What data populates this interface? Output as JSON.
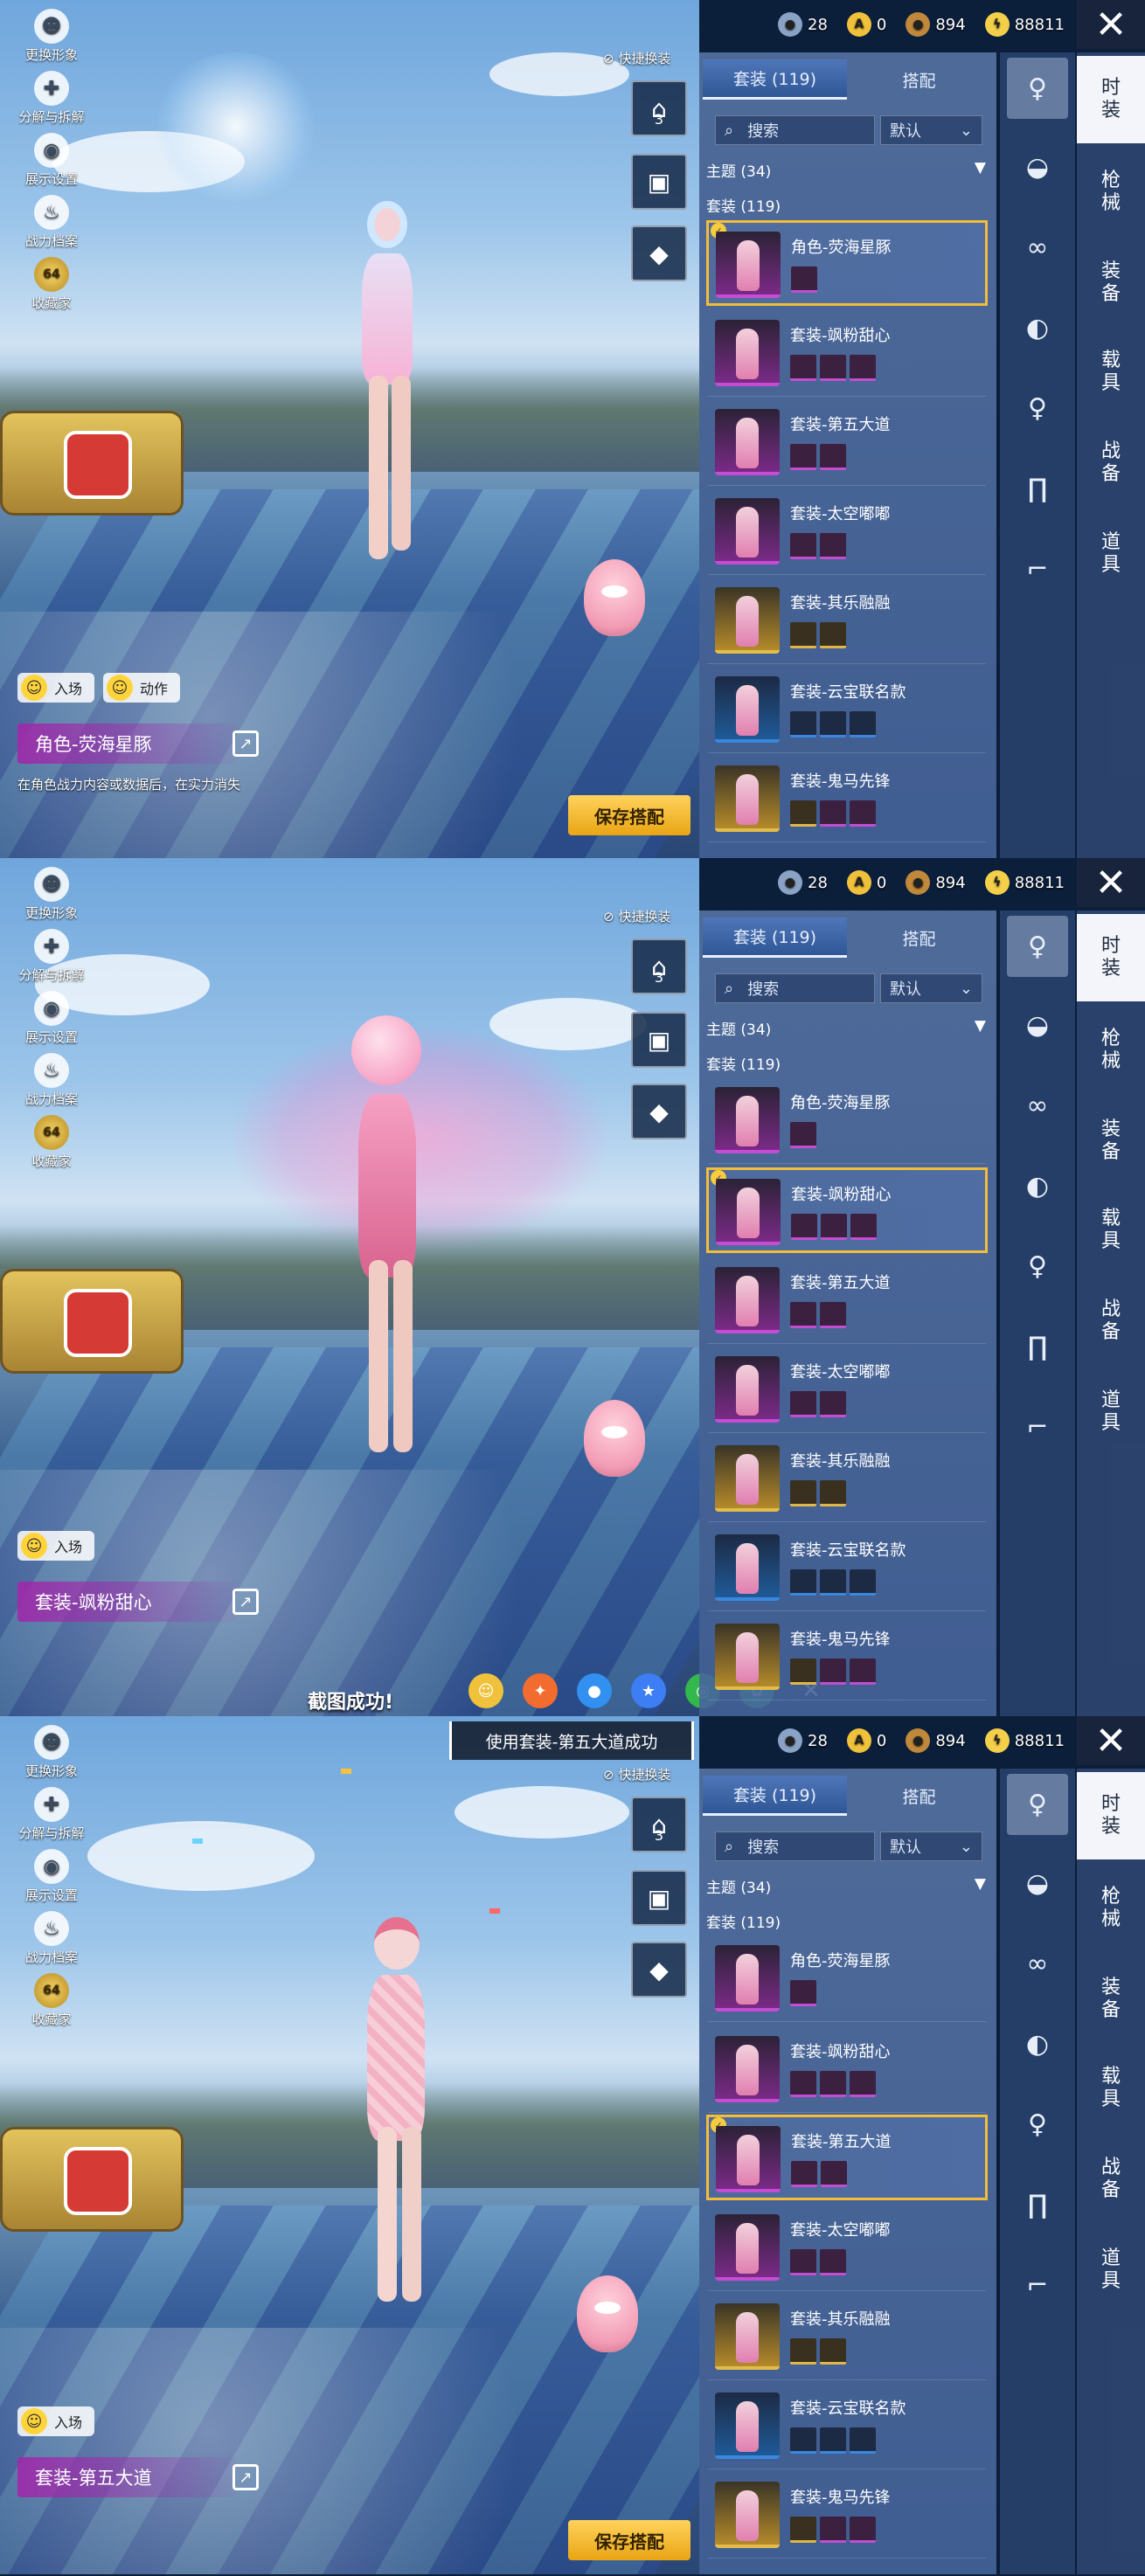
{
  "currency": {
    "a": "28",
    "b": "0",
    "c": "894",
    "d": "88811"
  },
  "left_menu": [
    "更换形象",
    "分解与拆解",
    "展示设置",
    "战力档案",
    "收藏家"
  ],
  "collector_level": "64",
  "quick_swap": "快捷换装",
  "wardrobe_number": "3",
  "tabs": [
    "套装 (119)",
    "搭配"
  ],
  "search_placeholder": "搜索",
  "sort_label": "默认",
  "theme_header": "主题 (34)",
  "suits_header": "套装 (119)",
  "rows": [
    "角色-荧海星豚",
    "套装-飒粉甜心",
    "套装-第五大道",
    "套装-太空嘟嘟",
    "套装-其乐融融",
    "套装-云宝联名款",
    "套装-鬼马先锋"
  ],
  "vertical_tabs": [
    "时装",
    "枪械",
    "装备",
    "载具",
    "战备",
    "道具"
  ],
  "entrance_label": "入场",
  "action_label": "动作",
  "save_label": "保存搭配",
  "panels": [
    {
      "item_name": "角色-荧海星豚",
      "hint": "在角色战力内容或数据后，在实力消失"
    },
    {
      "item_name": "套装-飒粉甜心",
      "toast": "截图成功!"
    },
    {
      "item_name": "套装-第五大道",
      "notification": "使用套装-第五大道成功"
    }
  ]
}
